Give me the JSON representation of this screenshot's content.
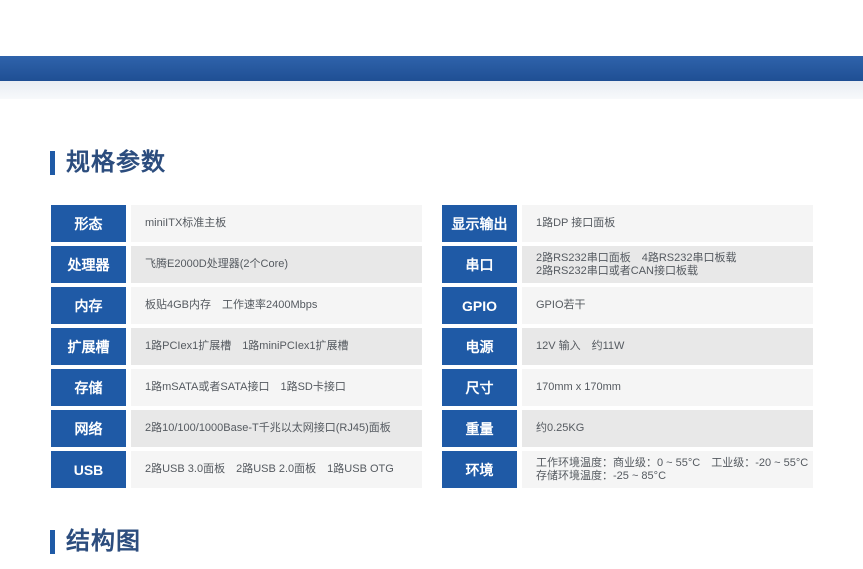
{
  "sections": {
    "specs_title": "规格参数",
    "structure_title": "结构图"
  },
  "specs_left": [
    {
      "label": "形态",
      "lines": [
        "miniITX标准主板"
      ]
    },
    {
      "label": "处理器",
      "lines": [
        "飞腾E2000D处理器(2个Core)"
      ]
    },
    {
      "label": "内存",
      "lines": [
        "板贴4GB内存　工作速率2400Mbps"
      ]
    },
    {
      "label": "扩展槽",
      "lines": [
        "1路PCIex1扩展槽　1路miniPCIex1扩展槽"
      ]
    },
    {
      "label": "存储",
      "lines": [
        "1路mSATA或者SATA接口　1路SD卡接口"
      ]
    },
    {
      "label": "网络",
      "lines": [
        "2路10/100/1000Base-T千兆以太网接口(RJ45)面板"
      ]
    },
    {
      "label": "USB",
      "lines": [
        "2路USB 3.0面板　2路USB 2.0面板　1路USB OTG"
      ]
    }
  ],
  "specs_right": [
    {
      "label": "显示输出",
      "lines": [
        "1路DP 接口面板"
      ]
    },
    {
      "label": "串口",
      "lines": [
        "2路RS232串口面板　4路RS232串口板载",
        "2路RS232串口或者CAN接口板载"
      ]
    },
    {
      "label": "GPIO",
      "lines": [
        "GPIO若干"
      ]
    },
    {
      "label": "电源",
      "lines": [
        "12V 输入　约11W"
      ]
    },
    {
      "label": "尺寸",
      "lines": [
        "170mm x 170mm"
      ]
    },
    {
      "label": "重量",
      "lines": [
        "约0.25KG"
      ]
    },
    {
      "label": "环境",
      "lines": [
        "工作环境温度：商业级：0 ~ 55°C　工业级：-20 ~ 55°C",
        "存储环境温度：-25 ~ 85°C"
      ]
    }
  ]
}
